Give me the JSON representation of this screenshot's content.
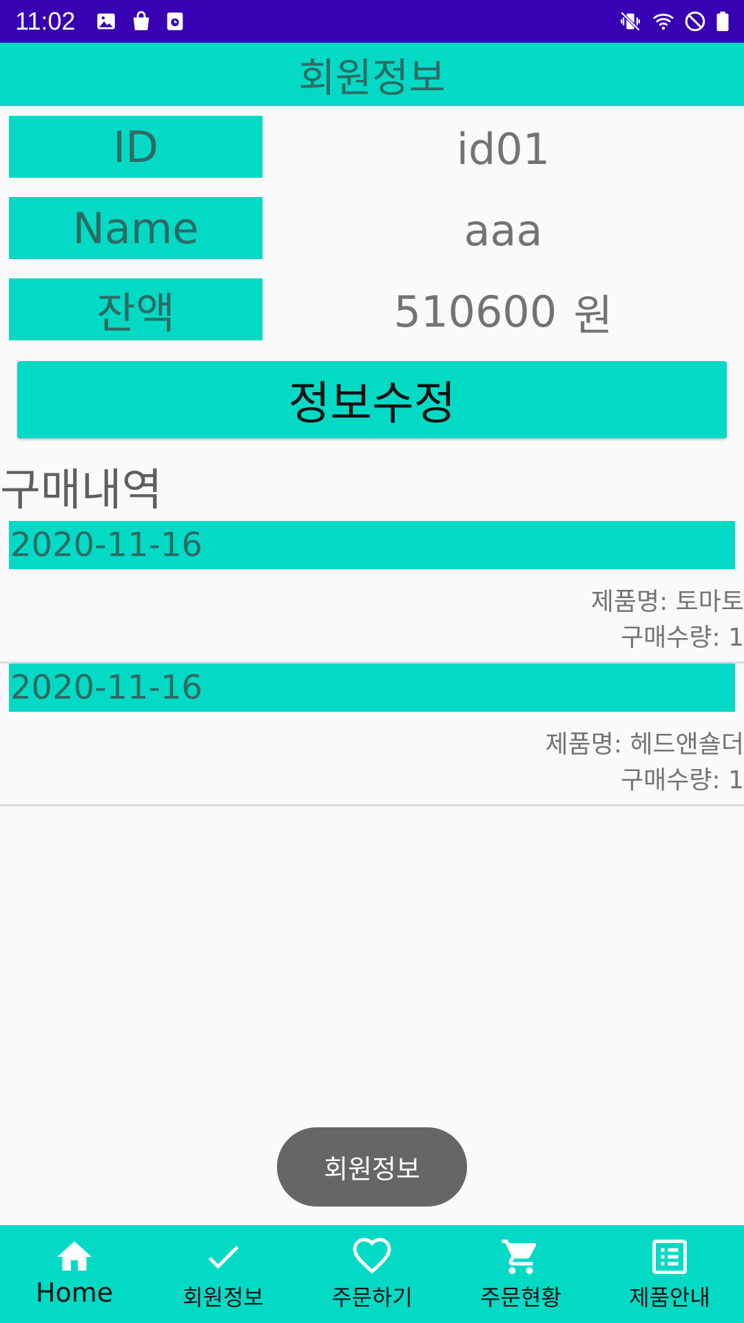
{
  "status_bar": {
    "time": "11:02",
    "left_icons": [
      "image-icon",
      "bag-icon",
      "media-icon"
    ],
    "right_icons": [
      "vibrate-icon",
      "wifi-icon",
      "dnd-icon",
      "battery-icon"
    ]
  },
  "header": {
    "title": "회원정보"
  },
  "profile": {
    "id_label": "ID",
    "id_value": "id01",
    "name_label": "Name",
    "name_value": "aaa",
    "balance_label": "잔액",
    "balance_value": "510600",
    "balance_unit": "원"
  },
  "edit_button": {
    "label": "정보수정"
  },
  "history": {
    "title": "구매내역",
    "items": [
      {
        "date": "2020-11-16",
        "product": "제품명: 토마토",
        "quantity": "구매수량: 1"
      },
      {
        "date": "2020-11-16",
        "product": "제품명: 헤드앤숄더",
        "quantity": "구매수량: 1"
      }
    ]
  },
  "toast": {
    "text": "회원정보"
  },
  "bottom_nav": {
    "items": [
      {
        "label": "Home",
        "icon": "home-icon",
        "active": true
      },
      {
        "label": "회원정보",
        "icon": "check-icon",
        "active": false
      },
      {
        "label": "주문하기",
        "icon": "heart-icon",
        "active": false
      },
      {
        "label": "주문현황",
        "icon": "cart-icon",
        "active": false
      },
      {
        "label": "제품안내",
        "icon": "list-icon",
        "active": false
      }
    ]
  },
  "colors": {
    "status_bar": "#3700b3",
    "accent": "#03dac5",
    "label_text": "#2e6b63",
    "value_text": "#737373",
    "toast_bg": "#666666"
  }
}
